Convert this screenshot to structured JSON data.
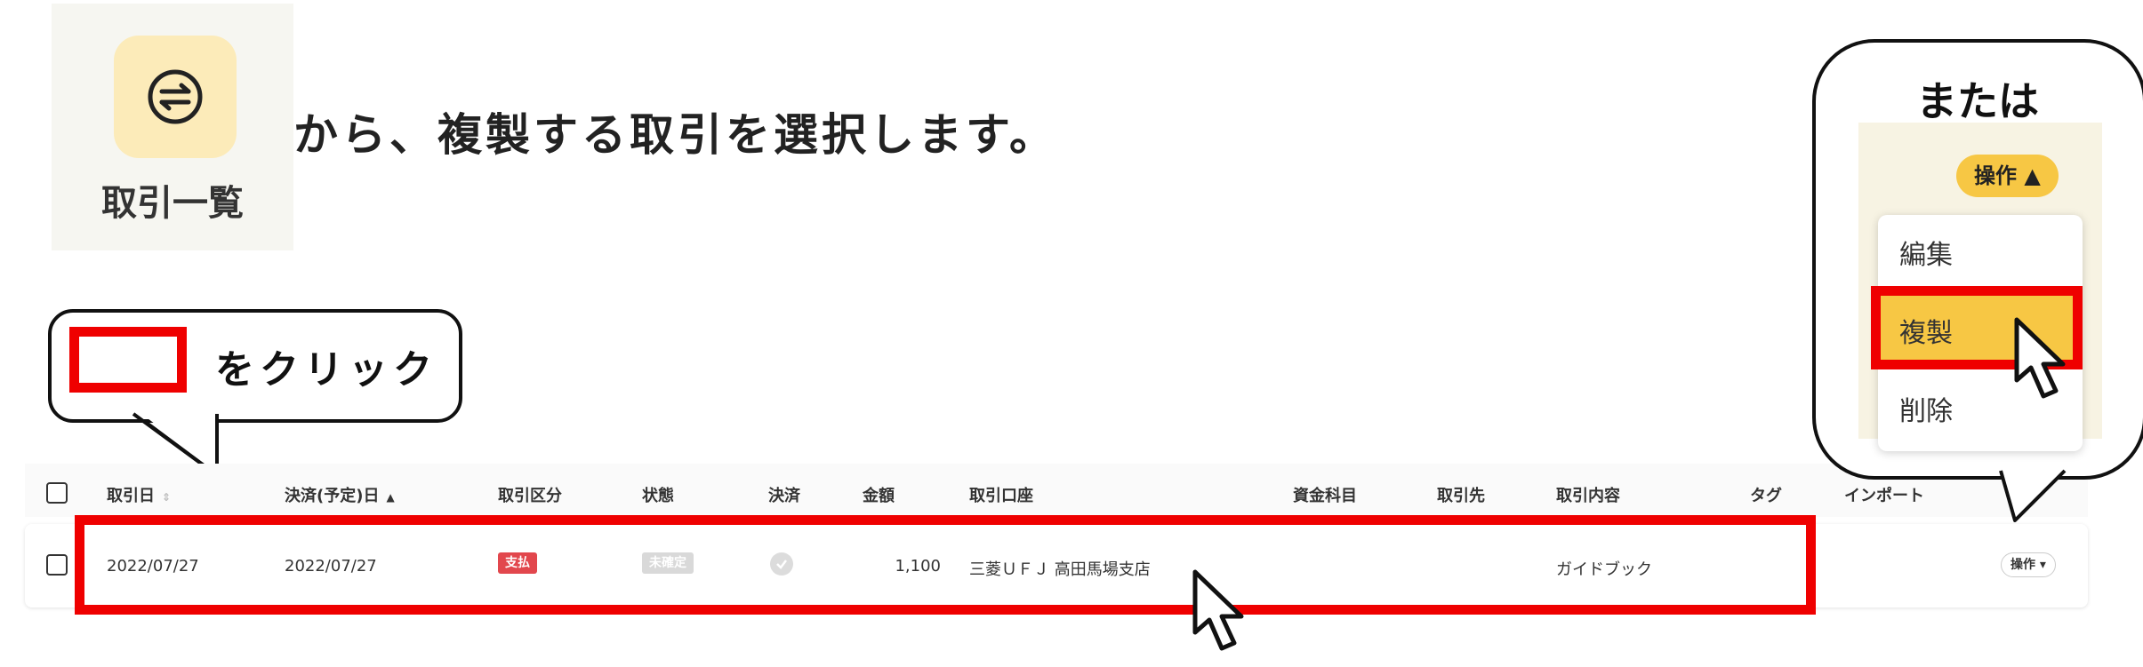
{
  "nav": {
    "label": "取引一覧",
    "icon": "exchange-icon"
  },
  "instruction": "から、複製する取引を選択します。",
  "callout_left": {
    "text": "をクリック"
  },
  "callout_right": {
    "title": "または"
  },
  "table": {
    "headers": {
      "date": "取引日",
      "settle_date": "決済(予定)日",
      "category": "取引区分",
      "status": "状態",
      "settlement": "決済",
      "amount": "金額",
      "account": "取引口座",
      "fund_item": "資金科目",
      "partner": "取引先",
      "content": "取引内容",
      "tag": "タグ",
      "import": "インポート"
    },
    "row": {
      "date": "2022/07/27",
      "settle_date": "2022/07/27",
      "category_badge": "支払",
      "status_badge": "未確定",
      "amount": "1,100",
      "account": "三菱ＵＦＪ 高田馬場支店",
      "content": "ガイドブック",
      "action_label": "操作 ▾"
    }
  },
  "dropdown": {
    "button_label": "操作 ▲",
    "items": [
      "編集",
      "複製",
      "削除"
    ]
  },
  "colors": {
    "highlight": "#ef0000",
    "accent": "#f7c744",
    "payment_badge": "#e2474d"
  }
}
